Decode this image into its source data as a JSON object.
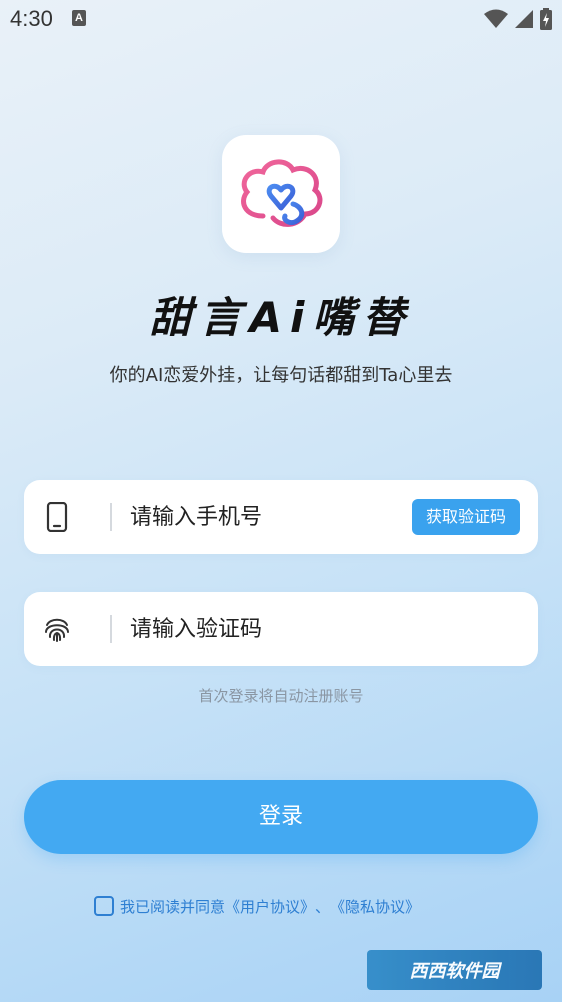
{
  "status_bar": {
    "time": "4:30",
    "notification_icon_letter": "A",
    "icons": [
      "wifi-icon",
      "signal-icon",
      "battery-icon"
    ]
  },
  "app": {
    "logo_icon": "heart-cloud-logo",
    "title": "甜言Ai嘴替",
    "subtitle": "你的AI恋爱外挂，让每句话都甜到Ta心里去"
  },
  "form": {
    "phone": {
      "icon": "phone-icon",
      "placeholder": "请输入手机号",
      "value": ""
    },
    "get_code_label": "获取验证码",
    "code": {
      "icon": "fingerprint-icon",
      "placeholder": "请输入验证码",
      "value": ""
    },
    "hint": "首次登录将自动注册账号",
    "login_label": "登录"
  },
  "agreement": {
    "checked": false,
    "prefix": "我已阅读并同意",
    "user_agreement": "《用户协议》",
    "separator": "、",
    "privacy_policy": "《隐私协议》"
  },
  "watermark": {
    "text": "西西软件园"
  },
  "colors": {
    "accent": "#43a9f2",
    "link": "#2e7fd2",
    "hint": "#8a96a3"
  }
}
